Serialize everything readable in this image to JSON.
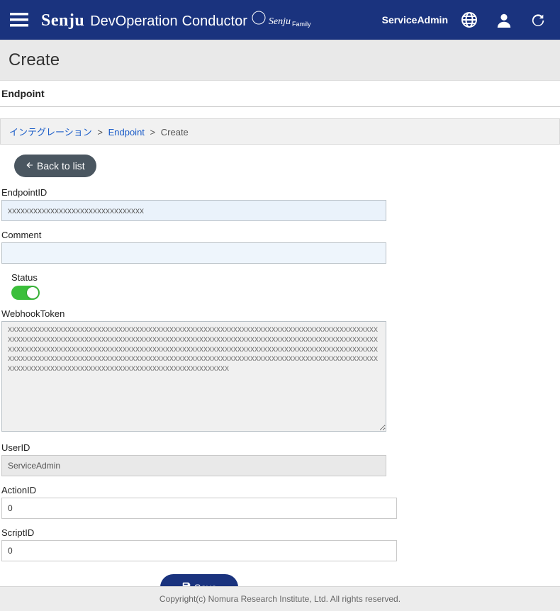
{
  "header": {
    "brand_main": "Senju",
    "brand_sub1": "DevOperation",
    "brand_sub2": "Conductor",
    "brand_logo_text": "Senju",
    "brand_logo_suffix": "Family",
    "user_label": "ServiceAdmin"
  },
  "title_strip": "Create",
  "section_title": "Endpoint",
  "breadcrumb": {
    "items": [
      {
        "label": "インテグレーション",
        "link": true
      },
      {
        "label": "Endpoint",
        "link": true
      },
      {
        "label": "Create",
        "link": false
      }
    ],
    "sep": ">"
  },
  "buttons": {
    "back": "Back to list",
    "save": "Save"
  },
  "fields": {
    "endpoint_id": {
      "label": "EndpointID",
      "value": "xxxxxxxxxxxxxxxxxxxxxxxxxxxxxxxx"
    },
    "comment": {
      "label": "Comment",
      "value": ""
    },
    "status": {
      "label": "Status",
      "on": true
    },
    "webhook": {
      "label": "WebhookToken",
      "value": "xxxxxxxxxxxxxxxxxxxxxxxxxxxxxxxxxxxxxxxxxxxxxxxxxxxxxxxxxxxxxxxxxxxxxxxxxxxxxxxxxxxxxxxxxxxxxxxxxxxxxxxxxxxxxxxxxxxxxxxxxxxxxxxxxxxxxxxxxxxxxxxxxxxxxxxxxxxxxxxxxxxxxxxxxxxxxxxxxxxxxxxxxxxxxxxxxxxxxxxxxxxxxxxxxxxxxxxxxxxxxxxxxxxxxxxxxxxxxxxxxxxxxxxxxxxxxxxxxxxxxxxxxxxxxxxxxxxxxxxxxxxxxxxxxxxxxxxxxxxxxxxxxxxxxxxxxxxxxxxxxxxxxxxxxxxxxxxxxxxxxxxxxxxxxxxxxxxxxxxxxxxxxxxxxxxxxxxxxxxxxxxxxxxxxxxxxxxxxxxx"
    },
    "user_id": {
      "label": "UserID",
      "value": "ServiceAdmin"
    },
    "action_id": {
      "label": "ActionID",
      "value": "0"
    },
    "script_id": {
      "label": "ScriptID",
      "value": "0"
    }
  },
  "footer": "Copyright(c) Nomura Research Institute, Ltd. All rights reserved."
}
